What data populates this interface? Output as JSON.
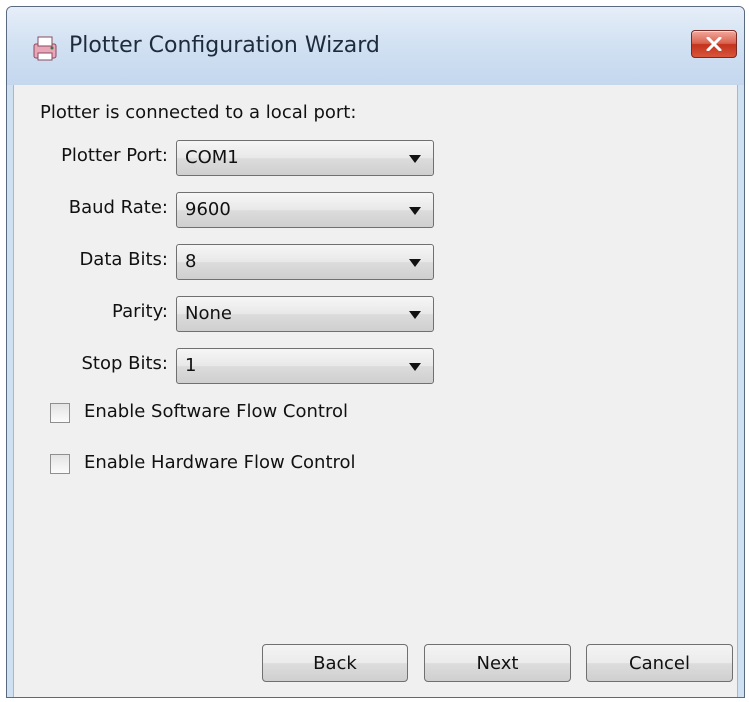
{
  "window": {
    "title": "Plotter Configuration Wizard",
    "accent_color": "#c4321c"
  },
  "form": {
    "section_label": "Plotter is connected to a local port:",
    "fields": [
      {
        "label": "Plotter Port:",
        "value": "COM1"
      },
      {
        "label": "Baud Rate:",
        "value": "9600"
      },
      {
        "label": "Data Bits:",
        "value": "8"
      },
      {
        "label": "Parity:",
        "value": "None"
      },
      {
        "label": "Stop Bits:",
        "value": "1"
      }
    ],
    "checkboxes": [
      {
        "label": "Enable Software Flow Control",
        "checked": false
      },
      {
        "label": "Enable Hardware Flow Control",
        "checked": false
      }
    ]
  },
  "buttons": {
    "back": "Back",
    "next": "Next",
    "cancel": "Cancel"
  }
}
